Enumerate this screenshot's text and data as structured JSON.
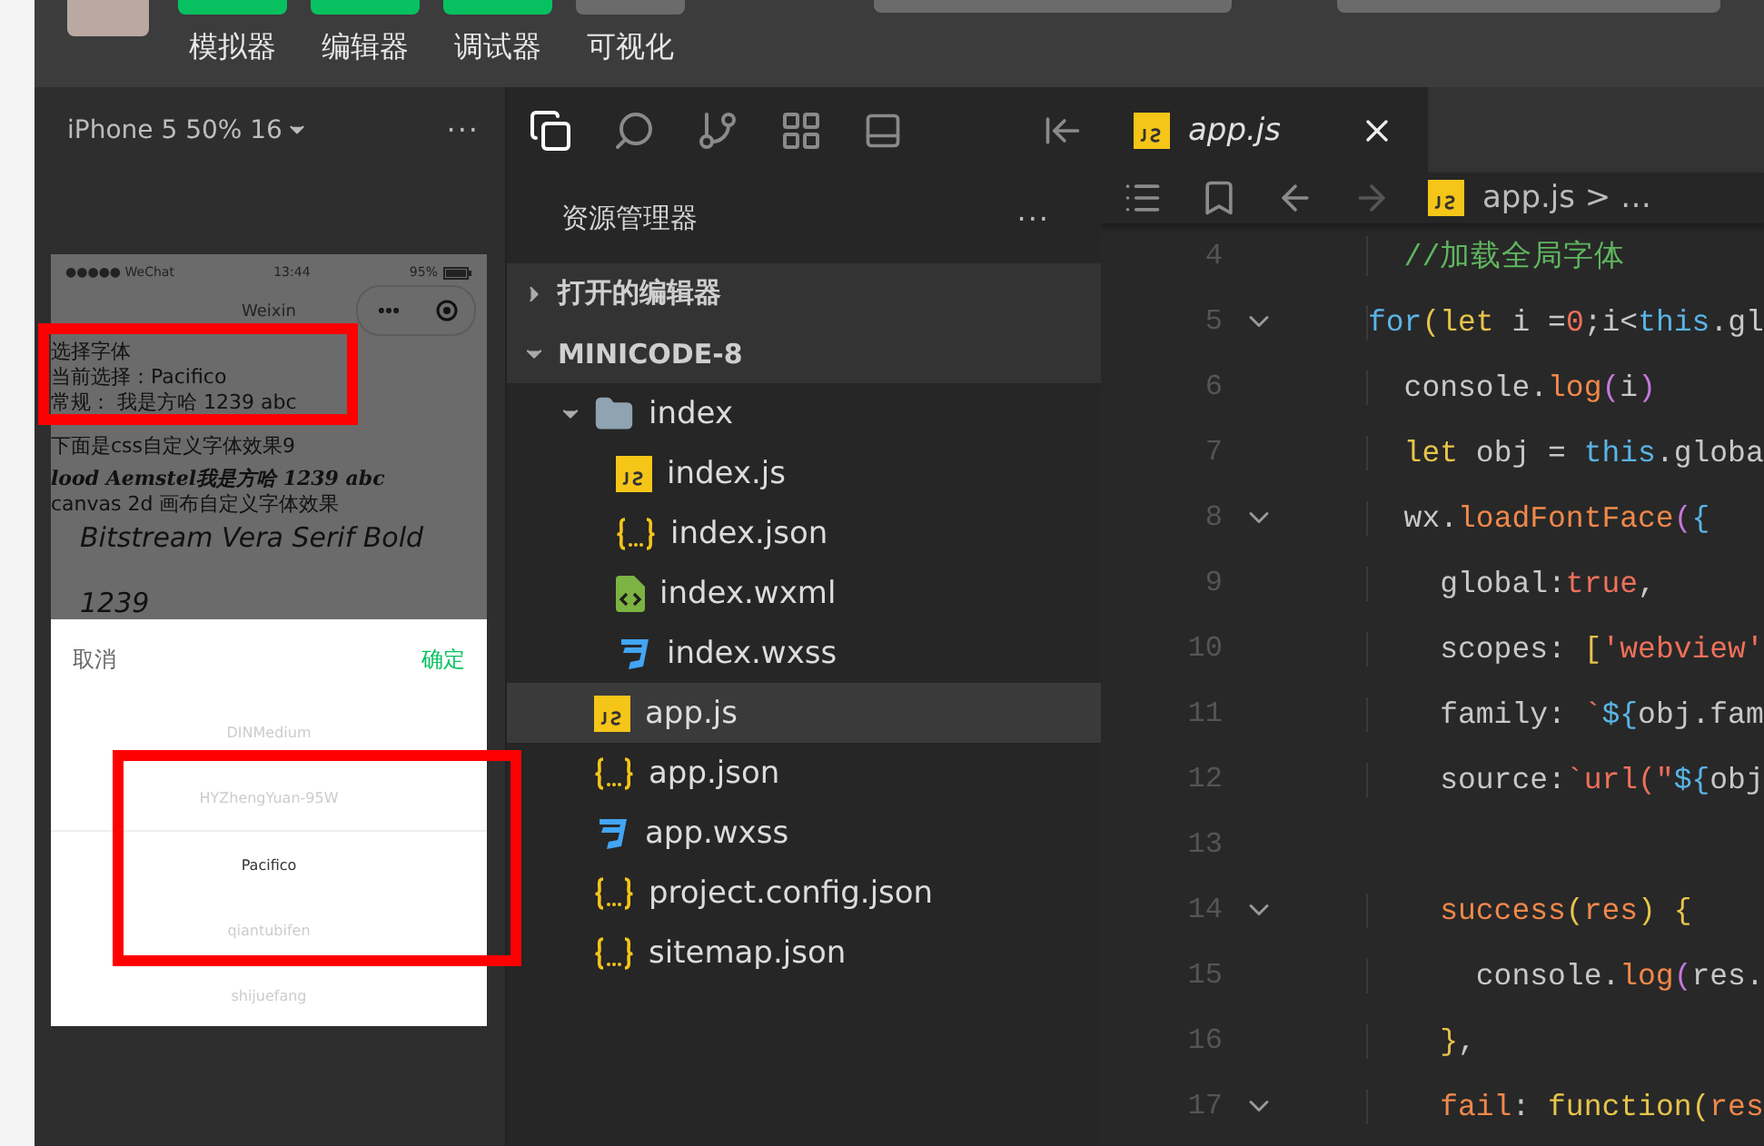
{
  "top_toolbar": {
    "items": [
      {
        "label": "模拟器",
        "active": true
      },
      {
        "label": "编辑器",
        "active": true
      },
      {
        "label": "调试器",
        "active": true
      },
      {
        "label": "可视化",
        "active": false
      }
    ]
  },
  "simulator": {
    "device": "iPhone 5 50% 16",
    "menu": "···",
    "status_bar": {
      "carrier": "●●●●● WeChat",
      "time": "13:44",
      "battery": "95%"
    },
    "nav_title": "Weixin",
    "content": [
      {
        "kind": "plain",
        "text": "选择字体"
      },
      {
        "kind": "plain",
        "text": "当前选择：Pacifico"
      },
      {
        "kind": "plain",
        "text": "常规： 我是方哈 1239 abc"
      },
      {
        "kind": "plain",
        "text": "下面是css自定义字体效果9"
      },
      {
        "kind": "script",
        "text": "lood Aemstel我是方哈 1239 abc"
      },
      {
        "kind": "plain",
        "text": "canvas 2d 画布自定义字体效果"
      },
      {
        "kind": "canvas",
        "text": "Bitstream Vera Serif Bold"
      },
      {
        "kind": "canvas",
        "text": "1239"
      }
    ],
    "picker": {
      "cancel": "取消",
      "confirm": "确定",
      "options": [
        {
          "label": "DINMedium",
          "selected": false
        },
        {
          "label": "HYZhengYuan-95W",
          "selected": false
        },
        {
          "label": "Pacifico",
          "selected": true
        },
        {
          "label": "qiantubifen",
          "selected": false
        },
        {
          "label": "shijuefang",
          "selected": false
        }
      ]
    }
  },
  "explorer": {
    "title": "资源管理器",
    "more": "···",
    "sections": [
      {
        "label": "打开的编辑器",
        "expanded": false
      },
      {
        "label": "MINICODE-8",
        "expanded": true,
        "children": [
          {
            "kind": "folder",
            "label": "index",
            "expanded": true,
            "selected": false,
            "children": [
              {
                "kind": "js",
                "label": "index.js",
                "selected": false
              },
              {
                "kind": "json",
                "label": "index.json",
                "selected": false
              },
              {
                "kind": "wxml",
                "label": "index.wxml",
                "selected": false
              },
              {
                "kind": "wxss",
                "label": "index.wxss",
                "selected": false
              }
            ]
          },
          {
            "kind": "js",
            "label": "app.js",
            "selected": true
          },
          {
            "kind": "json",
            "label": "app.json",
            "selected": false
          },
          {
            "kind": "wxss",
            "label": "app.wxss",
            "selected": false
          },
          {
            "kind": "json",
            "label": "project.config.json",
            "selected": false
          },
          {
            "kind": "json",
            "label": "sitemap.json",
            "selected": false
          }
        ]
      }
    ]
  },
  "editor": {
    "tabs": [
      {
        "label": "app.js",
        "selected": true
      }
    ],
    "breadcrumb": {
      "file": "app.js",
      "separator": ">",
      "more": "…"
    },
    "lines": [
      {
        "number": "4",
        "foldable": false,
        "tokens": [
          {
            "kind": "comment",
            "text": "  //加载全局字体"
          }
        ]
      },
      {
        "number": "5",
        "foldable": true,
        "tokens": [
          {
            "kind": "keyword",
            "text": "for"
          },
          {
            "kind": "paren",
            "text": "("
          },
          {
            "kind": "decl",
            "text": "let"
          },
          {
            "kind": "plain",
            "text": " i ="
          },
          {
            "kind": "number",
            "text": "0"
          },
          {
            "kind": "plain",
            "text": ";i<"
          },
          {
            "kind": "keyword",
            "text": "this"
          },
          {
            "kind": "plain",
            "text": ".gl"
          }
        ]
      },
      {
        "number": "6",
        "foldable": false,
        "tokens": [
          {
            "kind": "plain",
            "text": "  console."
          },
          {
            "kind": "method",
            "text": "log"
          },
          {
            "kind": "paren2",
            "text": "("
          },
          {
            "kind": "plain",
            "text": "i"
          },
          {
            "kind": "paren2",
            "text": ")"
          }
        ]
      },
      {
        "number": "7",
        "foldable": false,
        "tokens": [
          {
            "kind": "decl",
            "text": "  let"
          },
          {
            "kind": "plain",
            "text": " obj = "
          },
          {
            "kind": "keyword",
            "text": "this"
          },
          {
            "kind": "plain",
            "text": ".globa"
          }
        ]
      },
      {
        "number": "8",
        "foldable": true,
        "tokens": [
          {
            "kind": "plain",
            "text": "  wx."
          },
          {
            "kind": "method",
            "text": "loadFontFace"
          },
          {
            "kind": "paren2",
            "text": "("
          },
          {
            "kind": "keyword",
            "text": "{"
          }
        ]
      },
      {
        "number": "9",
        "foldable": false,
        "tokens": [
          {
            "kind": "plain",
            "text": "    global:"
          },
          {
            "kind": "number",
            "text": "true"
          },
          {
            "kind": "plain",
            "text": ","
          }
        ]
      },
      {
        "number": "10",
        "foldable": false,
        "tokens": [
          {
            "kind": "plain",
            "text": "    scopes: "
          },
          {
            "kind": "paren",
            "text": "["
          },
          {
            "kind": "number",
            "text": "'webview'"
          }
        ]
      },
      {
        "number": "11",
        "foldable": false,
        "tokens": [
          {
            "kind": "plain",
            "text": "    family: "
          },
          {
            "kind": "number",
            "text": "`"
          },
          {
            "kind": "keyword",
            "text": "${"
          },
          {
            "kind": "plain",
            "text": "obj.fam"
          }
        ]
      },
      {
        "number": "12",
        "foldable": false,
        "tokens": [
          {
            "kind": "plain",
            "text": "    source:"
          },
          {
            "kind": "number",
            "text": "`url(\""
          },
          {
            "kind": "keyword",
            "text": "${"
          },
          {
            "kind": "plain",
            "text": "obj"
          }
        ]
      },
      {
        "number": "13",
        "foldable": false
      },
      {
        "number": "14",
        "foldable": true,
        "tokens": [
          {
            "kind": "method",
            "text": "    success"
          },
          {
            "kind": "paren",
            "text": "("
          },
          {
            "kind": "param",
            "text": "res"
          },
          {
            "kind": "paren",
            "text": ")"
          },
          {
            "kind": "paren",
            "text": " {"
          }
        ]
      },
      {
        "number": "15",
        "foldable": false,
        "tokens": [
          {
            "kind": "plain",
            "text": "      console."
          },
          {
            "kind": "method",
            "text": "log"
          },
          {
            "kind": "paren2",
            "text": "("
          },
          {
            "kind": "plain",
            "text": "res."
          }
        ]
      },
      {
        "number": "16",
        "foldable": false,
        "tokens": [
          {
            "kind": "paren",
            "text": "    }"
          },
          {
            "kind": "plain",
            "text": ","
          }
        ]
      },
      {
        "number": "17",
        "foldable": true,
        "tokens": [
          {
            "kind": "method",
            "text": "    fail"
          },
          {
            "kind": "plain",
            "text": ": "
          },
          {
            "kind": "decl",
            "text": "function"
          },
          {
            "kind": "paren",
            "text": "("
          },
          {
            "kind": "param",
            "text": "res"
          }
        ]
      }
    ]
  }
}
